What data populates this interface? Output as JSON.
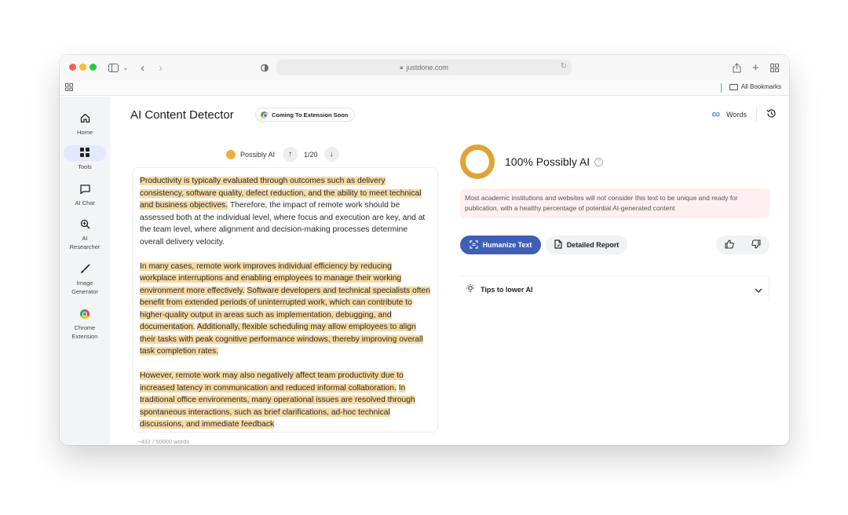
{
  "browser": {
    "url": "justdone.com",
    "bookmarks_label": "All Bookmarks"
  },
  "sidebar": {
    "items": [
      {
        "label": "Home",
        "icon": "home-icon"
      },
      {
        "label": "Tools",
        "icon": "grid-icon"
      },
      {
        "label": "AI Chat",
        "icon": "chat-icon"
      },
      {
        "label": "AI Researcher",
        "icon": "magnifier-icon"
      },
      {
        "label": "Image Generator",
        "icon": "brush-icon"
      },
      {
        "label": "Chrome Extension",
        "icon": "chrome-icon"
      }
    ]
  },
  "header": {
    "title": "AI Content Detector",
    "badge": "Coming To Extension Soon",
    "words_label": "Words"
  },
  "navigator": {
    "label": "Possibly AI",
    "position": "1/20"
  },
  "text": {
    "p1_h1": "Productivity is typically evaluated through outcomes such as delivery consistency, software quality, defect reduction, and the ability to meet technical and business objectives.",
    "p1_rest": " Therefore, the impact of remote work should be assessed both at the individual level, where focus and execution are key, and at the team level, where alignment and decision-making processes determine overall delivery velocity.",
    "p2_h1": "In many cases, remote work improves individual efficiency by reducing workplace interruptions and enabling employees to manage their working environment more effectively.",
    "p2_h2": "Software developers and technical specialists often benefit from extended periods of uninterrupted work, which can contribute to higher-quality output in areas such as implementation, debugging, and documentation.",
    "p2_h3": "Additionally, flexible scheduling may allow employees to align their tasks with peak cognitive performance windows, thereby improving overall task completion rates.",
    "p3_h1": "However, remote work may also negatively affect team productivity due to increased latency in communication and reduced informal collaboration.",
    "p3_h2": "In traditional office environments, many operational issues are resolved through spontaneous interactions, such as brief clarifications, ad-hoc technical discussions, and immediate feedback",
    "word_count": "~432 / 50000 words"
  },
  "result": {
    "score": "100% Possibly AI",
    "score_fraction": 1.0,
    "notice": "Most academic institutions and websites will not consider this text to be unique and ready for publication, with a healthy percentage of potential AI-generated content",
    "humanize_label": "Humanize Text",
    "report_label": "Detailed Report",
    "tips_label": "Tips to lower AI"
  },
  "colors": {
    "highlight": "#f6d9a3",
    "accent": "#3f5fb6",
    "donut": "#e0a336"
  }
}
